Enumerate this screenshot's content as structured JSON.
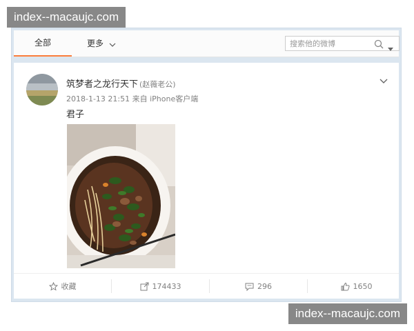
{
  "watermark": {
    "top_text": "index--macaujc.com",
    "bottom_text": "index--macaujc.com"
  },
  "tabs": {
    "all": "全部",
    "more": "更多"
  },
  "search": {
    "placeholder": "搜索他的微博"
  },
  "post": {
    "author": "筑梦者之龙行天下",
    "remark": "(赵薇老公)",
    "time": "2018-1-13 21:51",
    "source": "来自 iPhone客户端",
    "text": "君子"
  },
  "actions": {
    "favorite": "收藏",
    "repost": "174433",
    "comment": "296",
    "like": "1650"
  },
  "icons": [
    "search-icon",
    "dropdown-arrow-icon",
    "chevron-down-icon",
    "star-icon",
    "repost-icon",
    "comment-icon",
    "thumbs-up-icon"
  ],
  "colors": {
    "active_tab": "#fa7d3c",
    "frame": "#dbe6f0",
    "meta_text": "#808080"
  }
}
